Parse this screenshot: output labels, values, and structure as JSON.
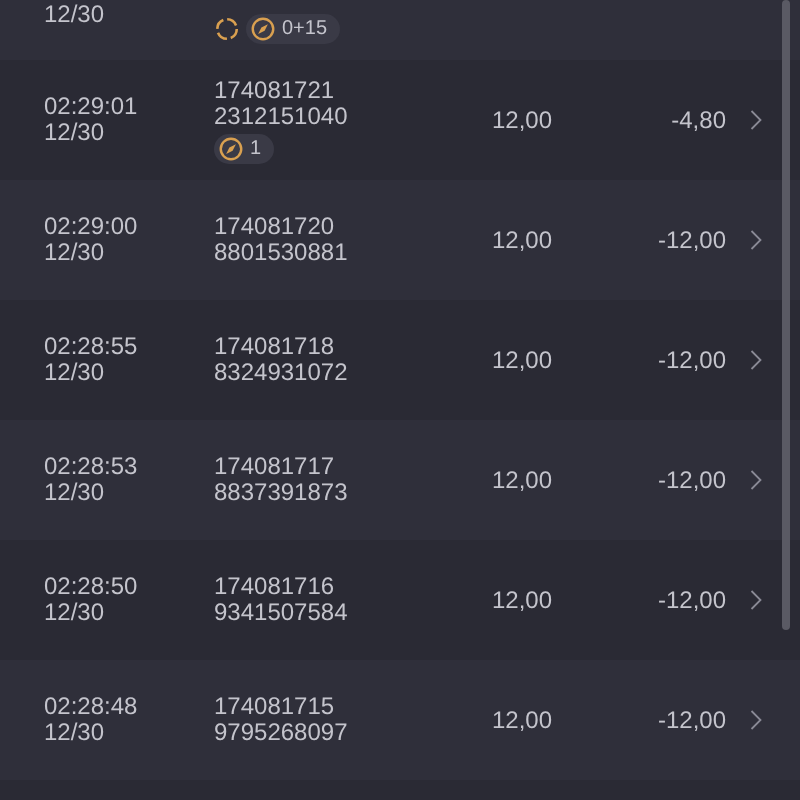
{
  "rows": [
    {
      "date": "12/30",
      "badges": [
        {
          "kind": "refresh"
        },
        {
          "kind": "coupon",
          "text": "0+15"
        }
      ]
    },
    {
      "time": "02:29:01",
      "date": "12/30",
      "id": "174081721",
      "number": "2312151040",
      "amount": "12,00",
      "result": "-4,80",
      "badges": [
        {
          "kind": "coupon",
          "text": "1"
        }
      ]
    },
    {
      "time": "02:29:00",
      "date": "12/30",
      "id": "174081720",
      "number": "8801530881",
      "amount": "12,00",
      "result": "-12,00"
    },
    {
      "time": "02:28:55",
      "date": "12/30",
      "id": "174081718",
      "number": "8324931072",
      "amount": "12,00",
      "result": "-12,00"
    },
    {
      "time": "02:28:53",
      "date": "12/30",
      "id": "174081717",
      "number": "8837391873",
      "amount": "12,00",
      "result": "-12,00"
    },
    {
      "time": "02:28:50",
      "date": "12/30",
      "id": "174081716",
      "number": "9341507584",
      "amount": "12,00",
      "result": "-12,00"
    },
    {
      "time": "02:28:48",
      "date": "12/30",
      "id": "174081715",
      "number": "9795268097",
      "amount": "12,00",
      "result": "-12,00"
    }
  ]
}
